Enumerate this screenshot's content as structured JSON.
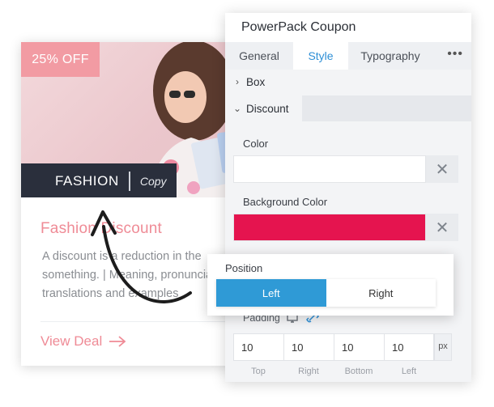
{
  "coupon": {
    "badge": "25% OFF",
    "code": "FASHION",
    "copy_label": "Copy",
    "title": "Fashion Discount",
    "description": "A discount is a reduction in the something. | Meaning, pronunciation, translations and examples",
    "link_label": "View Deal",
    "colors": {
      "badge": "#f29ba3",
      "code_bar": "#2a2f3c",
      "accent": "#ef8b96"
    }
  },
  "panel": {
    "title": "PowerPack Coupon",
    "tabs": [
      {
        "label": "General",
        "active": false
      },
      {
        "label": "Style",
        "active": true
      },
      {
        "label": "Typography",
        "active": false
      }
    ],
    "more_icon": "more-dots-icon",
    "sections": {
      "box": "Box",
      "discount": "Discount"
    },
    "color_label": "Color",
    "color_value": "#ffffff",
    "bg_color_label": "Background Color",
    "bg_color_value": "#e5144f",
    "clear_glyph": "✕",
    "padding_label": "Padding",
    "padding": {
      "values": [
        "10",
        "10",
        "10",
        "10"
      ],
      "sides": [
        "Top",
        "Right",
        "Bottom",
        "Left"
      ],
      "unit": "px"
    }
  },
  "position_popup": {
    "label": "Position",
    "options": [
      {
        "label": "Left",
        "selected": true
      },
      {
        "label": "Right",
        "selected": false
      }
    ]
  }
}
